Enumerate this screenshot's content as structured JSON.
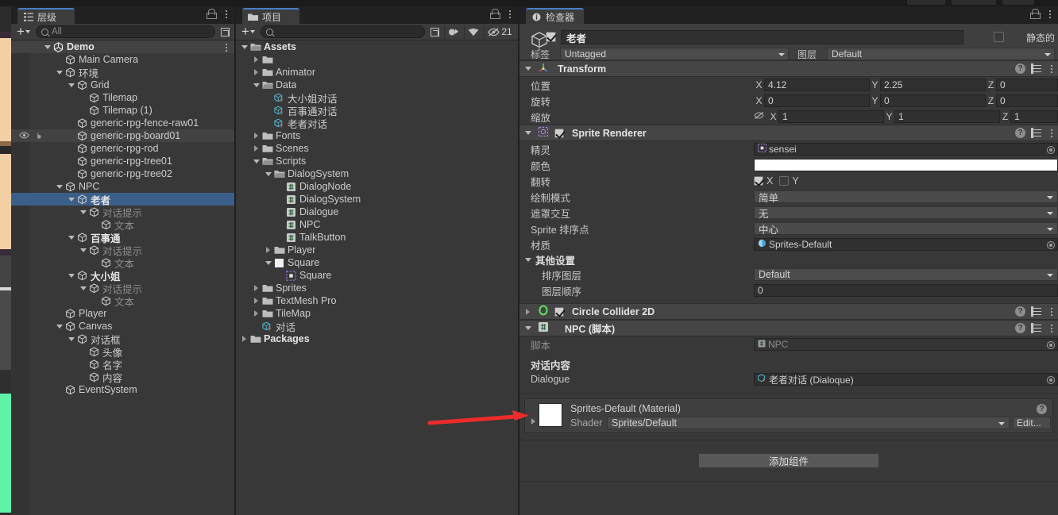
{
  "app": {
    "accent": "#4a7dc4",
    "selection_color": "#3a5f8a",
    "bg": "#383838"
  },
  "hierarchy": {
    "tab_label": "层级",
    "tab_icon": "hierarchy-icon",
    "toolbar": {
      "add_label": "+",
      "search_placeholder": "All",
      "search_value": ""
    },
    "items": [
      {
        "label": "Demo",
        "depth": 1,
        "arrow": "down",
        "icon": "unity-scene-icon",
        "bold": true,
        "state": "header"
      },
      {
        "label": "Main Camera",
        "depth": 2,
        "arrow": "none",
        "icon": "gameobject-icon"
      },
      {
        "label": "环境",
        "depth": 2,
        "arrow": "down",
        "icon": "gameobject-icon"
      },
      {
        "label": "Grid",
        "depth": 3,
        "arrow": "down",
        "icon": "gameobject-icon"
      },
      {
        "label": "Tilemap",
        "depth": 4,
        "arrow": "none",
        "icon": "gameobject-icon"
      },
      {
        "label": "Tilemap (1)",
        "depth": 4,
        "arrow": "none",
        "icon": "gameobject-icon"
      },
      {
        "label": "generic-rpg-fence-raw01",
        "depth": 3,
        "arrow": "none",
        "icon": "gameobject-icon"
      },
      {
        "label": "generic-rpg-board01",
        "depth": 3,
        "arrow": "none",
        "icon": "gameobject-icon",
        "state": "hover",
        "vis_icons": true
      },
      {
        "label": "generic-rpg-rod",
        "depth": 3,
        "arrow": "none",
        "icon": "gameobject-icon"
      },
      {
        "label": "generic-rpg-tree01",
        "depth": 3,
        "arrow": "none",
        "icon": "gameobject-icon"
      },
      {
        "label": "generic-rpg-tree02",
        "depth": 3,
        "arrow": "none",
        "icon": "gameobject-icon"
      },
      {
        "label": "NPC",
        "depth": 2,
        "arrow": "down",
        "icon": "gameobject-icon"
      },
      {
        "label": "老者",
        "depth": 3,
        "arrow": "down",
        "icon": "gameobject-icon",
        "bold": true,
        "state": "selected"
      },
      {
        "label": "对话提示",
        "depth": 4,
        "arrow": "down",
        "icon": "gameobject-icon",
        "dim": true
      },
      {
        "label": "文本",
        "depth": 5,
        "arrow": "none",
        "icon": "gameobject-icon",
        "dim": true
      },
      {
        "label": "百事通",
        "depth": 3,
        "arrow": "down",
        "icon": "gameobject-icon",
        "bold": true
      },
      {
        "label": "对话提示",
        "depth": 4,
        "arrow": "down",
        "icon": "gameobject-icon",
        "dim": true
      },
      {
        "label": "文本",
        "depth": 5,
        "arrow": "none",
        "icon": "gameobject-icon",
        "dim": true
      },
      {
        "label": "大小姐",
        "depth": 3,
        "arrow": "down",
        "icon": "gameobject-icon",
        "bold": true
      },
      {
        "label": "对话提示",
        "depth": 4,
        "arrow": "down",
        "icon": "gameobject-icon",
        "dim": true
      },
      {
        "label": "文本",
        "depth": 5,
        "arrow": "none",
        "icon": "gameobject-icon",
        "dim": true
      },
      {
        "label": "Player",
        "depth": 2,
        "arrow": "none",
        "icon": "gameobject-icon"
      },
      {
        "label": "Canvas",
        "depth": 2,
        "arrow": "down",
        "icon": "gameobject-icon"
      },
      {
        "label": "对话框",
        "depth": 3,
        "arrow": "down",
        "icon": "gameobject-icon"
      },
      {
        "label": "头像",
        "depth": 4,
        "arrow": "none",
        "icon": "gameobject-icon"
      },
      {
        "label": "名字",
        "depth": 4,
        "arrow": "none",
        "icon": "gameobject-icon"
      },
      {
        "label": "内容",
        "depth": 4,
        "arrow": "none",
        "icon": "gameobject-icon"
      },
      {
        "label": "EventSystem",
        "depth": 2,
        "arrow": "none",
        "icon": "gameobject-icon"
      }
    ]
  },
  "project": {
    "tab_label": "项目",
    "tab_icon": "folder-icon",
    "toolbar": {
      "add_label": "+",
      "search_placeholder": "",
      "search_value": "",
      "save_search_icon": "save-search-icon",
      "type_filter_icon": "type-filter-icon",
      "label_filter_icon": "label-filter-icon",
      "hidden_toggle_icon": "hidden-packages-icon",
      "hidden_count": "21"
    },
    "items": [
      {
        "label": "Assets",
        "depth": 0,
        "arrow": "down",
        "icon": "folder-open-icon",
        "bold": true
      },
      {
        "label": "",
        "depth": 1,
        "arrow": "right",
        "icon": "folder-icon"
      },
      {
        "label": "Animator",
        "depth": 1,
        "arrow": "right",
        "icon": "folder-icon"
      },
      {
        "label": "Data",
        "depth": 1,
        "arrow": "down",
        "icon": "folder-open-icon"
      },
      {
        "label": "大小姐对话",
        "depth": 2,
        "arrow": "none",
        "icon": "scriptable-object-icon"
      },
      {
        "label": "百事通对话",
        "depth": 2,
        "arrow": "none",
        "icon": "scriptable-object-icon"
      },
      {
        "label": "老者对话",
        "depth": 2,
        "arrow": "none",
        "icon": "scriptable-object-icon"
      },
      {
        "label": "Fonts",
        "depth": 1,
        "arrow": "right",
        "icon": "folder-icon"
      },
      {
        "label": "Scenes",
        "depth": 1,
        "arrow": "right",
        "icon": "folder-icon"
      },
      {
        "label": "Scripts",
        "depth": 1,
        "arrow": "down",
        "icon": "folder-open-icon"
      },
      {
        "label": "DialogSystem",
        "depth": 2,
        "arrow": "down",
        "icon": "folder-open-icon"
      },
      {
        "label": "DialogNode",
        "depth": 3,
        "arrow": "none",
        "icon": "csharp-script-icon"
      },
      {
        "label": "DialogSystem",
        "depth": 3,
        "arrow": "none",
        "icon": "csharp-script-icon"
      },
      {
        "label": "Dialogue",
        "depth": 3,
        "arrow": "none",
        "icon": "csharp-script-icon"
      },
      {
        "label": "NPC",
        "depth": 3,
        "arrow": "none",
        "icon": "csharp-script-icon"
      },
      {
        "label": "TalkButton",
        "depth": 3,
        "arrow": "none",
        "icon": "csharp-script-icon"
      },
      {
        "label": "Player",
        "depth": 2,
        "arrow": "right",
        "icon": "folder-icon"
      },
      {
        "label": "Square",
        "depth": 2,
        "arrow": "down",
        "icon": "texture-icon"
      },
      {
        "label": "Square",
        "depth": 3,
        "arrow": "none",
        "icon": "sprite-icon"
      },
      {
        "label": "Sprites",
        "depth": 1,
        "arrow": "right",
        "icon": "folder-icon"
      },
      {
        "label": "TextMesh Pro",
        "depth": 1,
        "arrow": "right",
        "icon": "folder-icon"
      },
      {
        "label": "TileMap",
        "depth": 1,
        "arrow": "right",
        "icon": "folder-icon"
      },
      {
        "label": "对话",
        "depth": 1,
        "arrow": "none",
        "icon": "scriptable-object-icon"
      },
      {
        "label": "Packages",
        "depth": 0,
        "arrow": "right",
        "icon": "folder-icon",
        "bold": true
      }
    ]
  },
  "inspector": {
    "tab_label": "检查器",
    "tab_icon": "info-icon",
    "gameobject": {
      "enabled": true,
      "name": "老者",
      "static_label": "静态的",
      "static_checked": false,
      "tag_label": "标签",
      "tag_value": "Untagged",
      "layer_label": "图层",
      "layer_value": "Default"
    },
    "transform": {
      "title": "Transform",
      "rows": [
        {
          "label": "位置",
          "x": "4.12",
          "y": "2.25",
          "z": "0"
        },
        {
          "label": "旋转",
          "x": "0",
          "y": "0",
          "z": "0"
        },
        {
          "label": "缩放",
          "x": "1",
          "y": "1",
          "z": "1",
          "link_icon": "constrain-proportions-off-icon"
        }
      ],
      "axes": [
        "X",
        "Y",
        "Z"
      ]
    },
    "sprite_renderer": {
      "title": "Sprite Renderer",
      "enabled": true,
      "sprite_label": "精灵",
      "sprite_value": "sensei",
      "color_label": "颜色",
      "color_value": "#FFFFFF",
      "flip_label": "翻转",
      "flip_x_label": "X",
      "flip_x_checked": true,
      "flip_y_label": "Y",
      "flip_y_checked": false,
      "draw_mode_label": "绘制模式",
      "draw_mode_value": "简单",
      "mask_label": "遮罩交互",
      "mask_value": "无",
      "sort_point_label": "Sprite 排序点",
      "sort_point_value": "中心",
      "material_label": "材质",
      "material_value": "Sprites-Default",
      "other_settings_label": "其他设置",
      "sorting_layer_label": "排序图层",
      "sorting_layer_value": "Default",
      "order_label": "图层顺序",
      "order_value": "0"
    },
    "circle_collider": {
      "title": "Circle Collider 2D",
      "enabled": true
    },
    "npc_script": {
      "title": "NPC  (脚本)",
      "script_label": "脚本",
      "script_value": "NPC",
      "section_label": "对话内容",
      "dialogue_label": "Dialogue",
      "dialogue_value": "老者对话 (Dialoque)"
    },
    "material_preview": {
      "title": "Sprites-Default (Material)",
      "shader_label": "Shader",
      "shader_value": "Sprites/Default",
      "edit_label": "Edit..."
    },
    "add_component_label": "添加组件"
  },
  "annotation": {
    "arrow_color": "#ee2b2b",
    "points_to": "Dialogue"
  }
}
